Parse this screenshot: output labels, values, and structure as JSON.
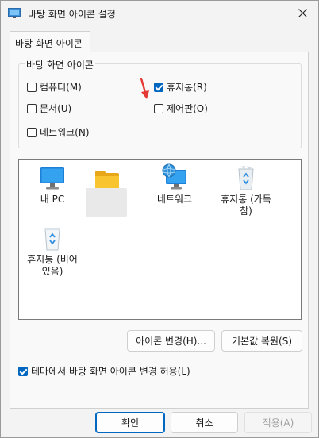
{
  "window": {
    "title": "바탕 화면 아이콘 설정"
  },
  "tab": {
    "label": "바탕 화면 아이콘"
  },
  "group": {
    "legend": "바탕 화면 아이콘",
    "checkboxes": [
      {
        "label": "컴퓨터(M)",
        "checked": false
      },
      {
        "label": "휴지통(R)",
        "checked": true
      },
      {
        "label": "문서(U)",
        "checked": false
      },
      {
        "label": "제어판(O)",
        "checked": false
      },
      {
        "label": "네트워크(N)",
        "checked": false
      }
    ]
  },
  "icons": [
    {
      "label": "내 PC",
      "icon": "monitor-icon"
    },
    {
      "label": "",
      "icon": "folder-icon"
    },
    {
      "label": "네트워크",
      "icon": "network-icon"
    },
    {
      "label": "휴지통 (가득 참)",
      "line1": "휴지통 (가득",
      "line2": "참)",
      "icon": "recycle-bin-full-icon"
    },
    {
      "label": "휴지통 (비어 있음)",
      "line1": "휴지통 (비어",
      "line2": "있음)",
      "icon": "recycle-bin-empty-icon"
    }
  ],
  "buttons": {
    "change_icon": "아이콘 변경(H)...",
    "restore_default": "기본값 복원(S)",
    "ok": "확인",
    "cancel": "취소",
    "apply": "적용(A)"
  },
  "theme_checkbox": {
    "label": "테마에서 바탕 화면 아이콘 변경 허용(L)",
    "checked": true
  },
  "colors": {
    "accent": "#0067c0",
    "arrow": "#e53935"
  }
}
